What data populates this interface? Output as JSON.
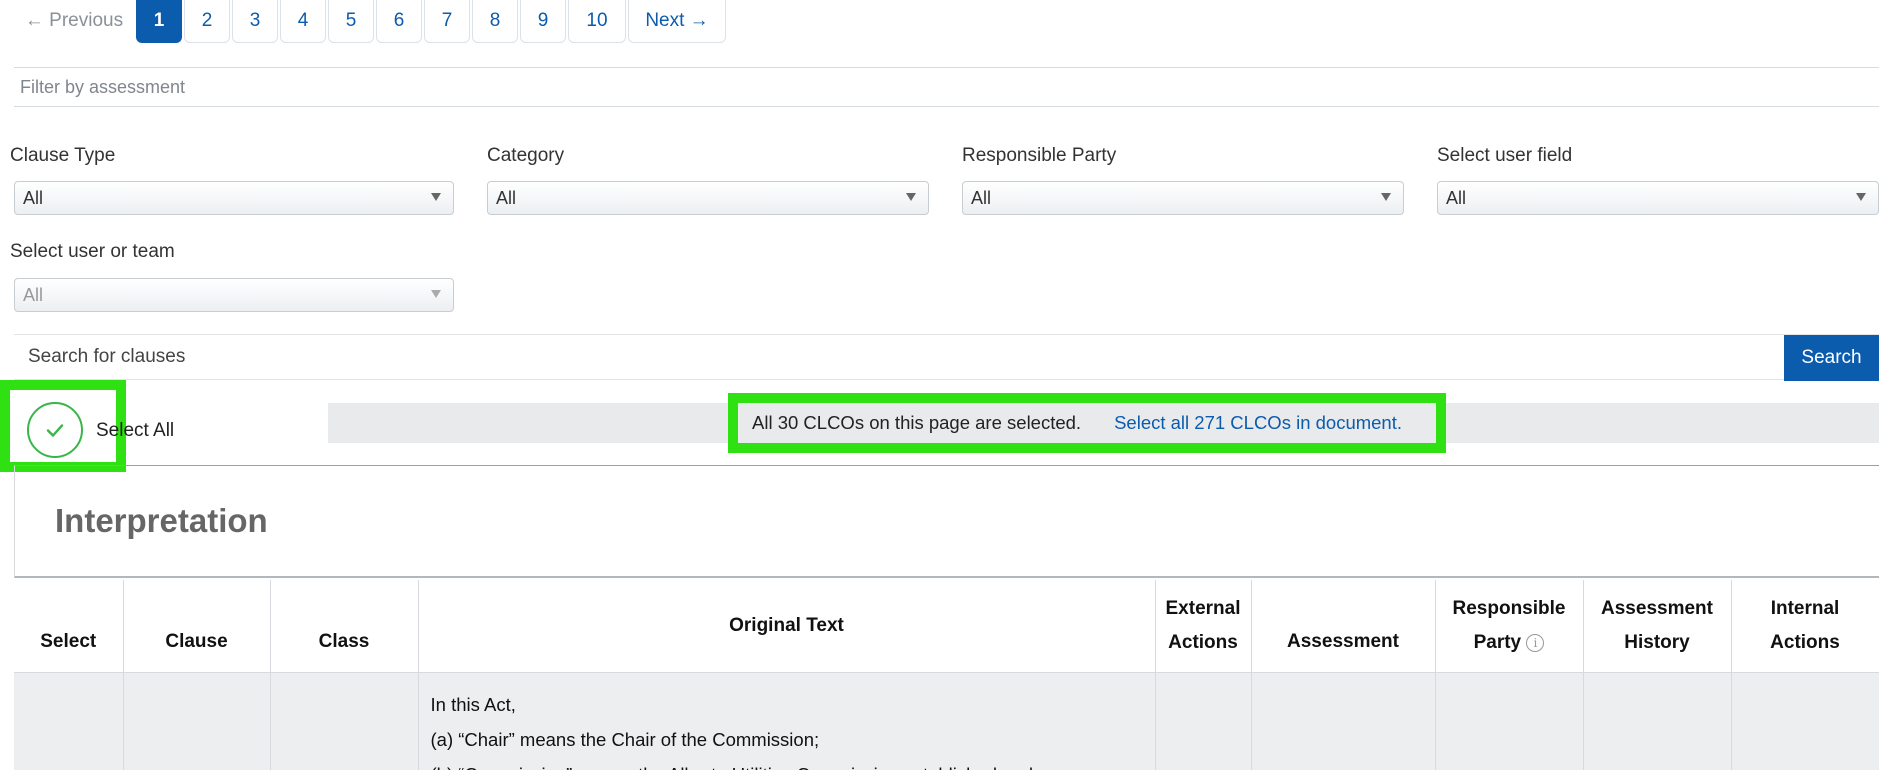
{
  "pagination": {
    "previous": "← Previous",
    "pages": [
      "1",
      "2",
      "3",
      "4",
      "5",
      "6",
      "7",
      "8",
      "9",
      "10"
    ],
    "active_page": "1",
    "next": "Next →"
  },
  "filter_assessment": {
    "placeholder": "Filter by assessment"
  },
  "filters": {
    "clause_type": {
      "label": "Clause Type",
      "value": "All"
    },
    "category": {
      "label": "Category",
      "value": "All"
    },
    "responsible_party": {
      "label": "Responsible Party",
      "value": "All"
    },
    "user_field": {
      "label": "Select user field",
      "value": "All"
    },
    "user_or_team": {
      "label": "Select user or team",
      "value": "All"
    }
  },
  "search": {
    "placeholder": "Search for clauses",
    "button": "Search"
  },
  "select_all": {
    "label": "Select All"
  },
  "selection_banner": {
    "message": "All 30 CLCOs on this page are selected.",
    "link": "Select all 271 CLCOs in document."
  },
  "section": {
    "title": "Interpretation"
  },
  "table": {
    "headers": {
      "select": "Select",
      "clause": "Clause",
      "class": "Class",
      "original_text": "Original Text",
      "external_actions_1": "External",
      "external_actions_2": "Actions",
      "assessment": "Assessment",
      "responsible_party_1": "Responsible",
      "responsible_party_2": "Party",
      "assessment_history_1": "Assessment",
      "assessment_history_2": "History",
      "internal_actions_1": "Internal",
      "internal_actions_2": "Actions"
    },
    "rows": [
      {
        "original_text": [
          "In this Act,",
          "(a) “Chair” means the Chair of the Commission;",
          "(b) “Commission” means the Alberta Utilities Commission established under"
        ]
      }
    ]
  },
  "colors": {
    "accent": "#0b5cad",
    "highlight": "#2fe012",
    "check": "#39b54a"
  }
}
